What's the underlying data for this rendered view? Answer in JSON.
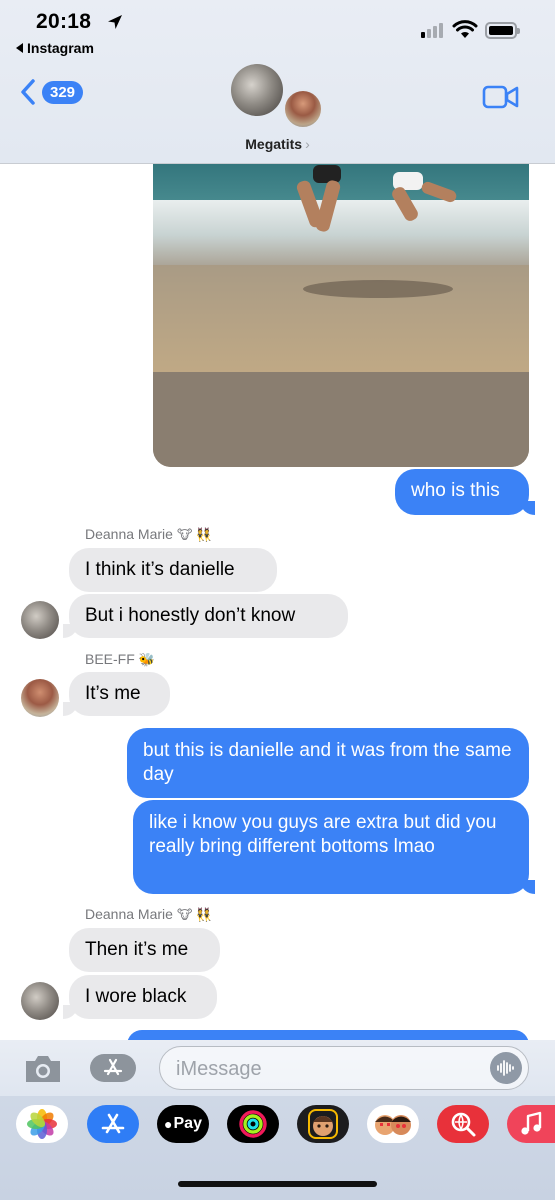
{
  "status": {
    "time": "20:18",
    "back_app": "Instagram"
  },
  "header": {
    "back_count": "329",
    "group_name": "Megatits"
  },
  "thread": {
    "msg1": "who is this",
    "sender1": "Deanna Marie",
    "sender1_emoji": "🐮 👯",
    "msg2": "I think it’s danielle",
    "msg3": "But i honestly don’t know",
    "sender2": "BEE-FF",
    "sender2_emoji": "🐝",
    "msg4": "It’s me",
    "msg5": "but this is danielle and it was from the same day",
    "msg6": "like i know you guys are extra but did you really bring different bottoms lmao",
    "sender3": "Deanna Marie",
    "sender3_emoji": "🐮 👯",
    "msg7": "Then it’s me",
    "msg8": "I wore black"
  },
  "input": {
    "placeholder": "iMessage"
  },
  "apps": [
    "photos-icon",
    "app-store-icon",
    "apple-pay-icon",
    "activity-icon",
    "memoji-icon",
    "memoji-stickers-icon",
    "web-images-icon",
    "music-icon"
  ],
  "apps_labels": {
    "apple_pay": "Pay"
  },
  "colors": {
    "accent": "#3b82f6",
    "incoming": "#e9e9eb"
  }
}
